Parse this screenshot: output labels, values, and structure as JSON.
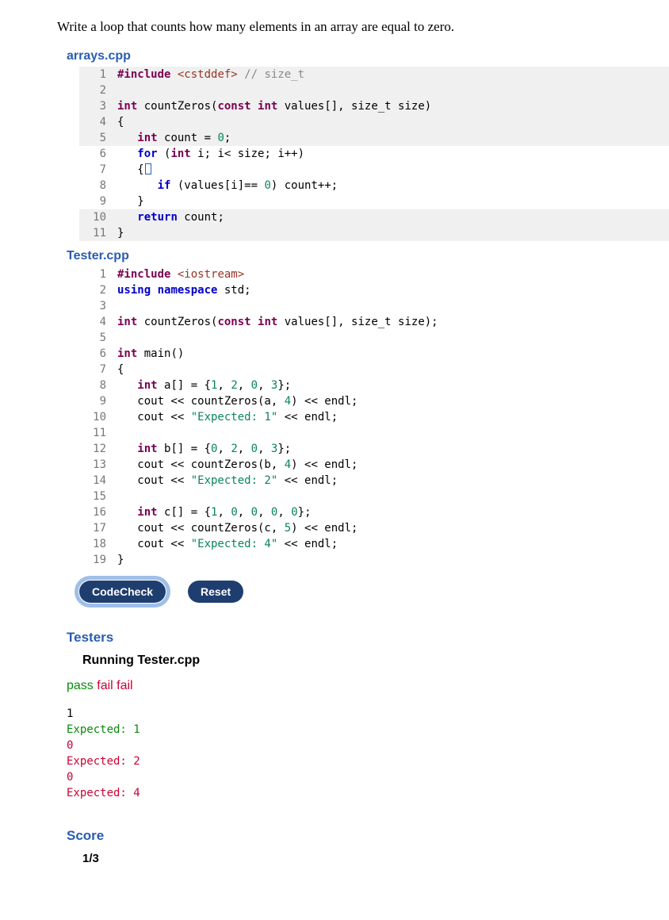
{
  "prompt": "Write a loop that counts how many elements in an array are equal to zero.",
  "files": {
    "arrays": {
      "name": "arrays.cpp",
      "lines": [
        {
          "n": "1",
          "bg": true,
          "tokens": [
            [
              "pre",
              "#include"
            ],
            [
              "pl",
              " "
            ],
            [
              "inc",
              "<cstddef>"
            ],
            [
              "pl",
              " "
            ],
            [
              "cmt",
              "// size_t"
            ]
          ]
        },
        {
          "n": "2",
          "bg": true,
          "tokens": []
        },
        {
          "n": "3",
          "bg": true,
          "tokens": [
            [
              "type",
              "int"
            ],
            [
              "pl",
              " countZeros("
            ],
            [
              "type",
              "const int"
            ],
            [
              "pl",
              " values[], size_t size)"
            ]
          ]
        },
        {
          "n": "4",
          "bg": true,
          "tokens": [
            [
              "pl",
              "{"
            ]
          ]
        },
        {
          "n": "5",
          "bg": true,
          "tokens": [
            [
              "pl",
              "   "
            ],
            [
              "type",
              "int"
            ],
            [
              "pl",
              " count = "
            ],
            [
              "num",
              "0"
            ],
            [
              "pl",
              ";"
            ]
          ]
        },
        {
          "n": "6",
          "bg": false,
          "tokens": [
            [
              "pl",
              "   "
            ],
            [
              "kw",
              "for"
            ],
            [
              "pl",
              " ("
            ],
            [
              "type",
              "int"
            ],
            [
              "pl",
              " i; i< size; i++)"
            ]
          ]
        },
        {
          "n": "7",
          "bg": false,
          "tokens": [
            [
              "pl",
              "   {"
            ],
            [
              "cursor",
              ""
            ]
          ]
        },
        {
          "n": "8",
          "bg": false,
          "tokens": [
            [
              "pl",
              "      "
            ],
            [
              "kw",
              "if"
            ],
            [
              "pl",
              " (values[i]== "
            ],
            [
              "num",
              "0"
            ],
            [
              "pl",
              ") count++;"
            ]
          ]
        },
        {
          "n": "9",
          "bg": false,
          "tokens": [
            [
              "pl",
              "   }"
            ]
          ]
        },
        {
          "n": "10",
          "bg": true,
          "tokens": [
            [
              "pl",
              "   "
            ],
            [
              "kw",
              "return"
            ],
            [
              "pl",
              " count;"
            ]
          ]
        },
        {
          "n": "11",
          "bg": true,
          "tokens": [
            [
              "pl",
              "}"
            ]
          ]
        }
      ]
    },
    "tester": {
      "name": "Tester.cpp",
      "lines": [
        {
          "n": "1",
          "tokens": [
            [
              "pre",
              "#include"
            ],
            [
              "pl",
              " "
            ],
            [
              "inc",
              "<iostream>"
            ]
          ]
        },
        {
          "n": "2",
          "tokens": [
            [
              "kw",
              "using"
            ],
            [
              "pl",
              " "
            ],
            [
              "kw",
              "namespace"
            ],
            [
              "pl",
              " std;"
            ]
          ]
        },
        {
          "n": "3",
          "tokens": []
        },
        {
          "n": "4",
          "tokens": [
            [
              "type",
              "int"
            ],
            [
              "pl",
              " countZeros("
            ],
            [
              "type",
              "const int"
            ],
            [
              "pl",
              " values[], size_t size);"
            ]
          ]
        },
        {
          "n": "5",
          "tokens": []
        },
        {
          "n": "6",
          "tokens": [
            [
              "type",
              "int"
            ],
            [
              "pl",
              " main()"
            ]
          ]
        },
        {
          "n": "7",
          "tokens": [
            [
              "pl",
              "{"
            ]
          ]
        },
        {
          "n": "8",
          "tokens": [
            [
              "pl",
              "   "
            ],
            [
              "type",
              "int"
            ],
            [
              "pl",
              " a[] = {"
            ],
            [
              "num",
              "1"
            ],
            [
              "pl",
              ", "
            ],
            [
              "num",
              "2"
            ],
            [
              "pl",
              ", "
            ],
            [
              "num",
              "0"
            ],
            [
              "pl",
              ", "
            ],
            [
              "num",
              "3"
            ],
            [
              "pl",
              "};"
            ]
          ]
        },
        {
          "n": "9",
          "tokens": [
            [
              "pl",
              "   cout << countZeros(a, "
            ],
            [
              "num",
              "4"
            ],
            [
              "pl",
              ") << endl;"
            ]
          ]
        },
        {
          "n": "10",
          "tokens": [
            [
              "pl",
              "   cout << "
            ],
            [
              "str",
              "\"Expected: 1\""
            ],
            [
              "pl",
              " << endl;"
            ]
          ]
        },
        {
          "n": "11",
          "tokens": []
        },
        {
          "n": "12",
          "tokens": [
            [
              "pl",
              "   "
            ],
            [
              "type",
              "int"
            ],
            [
              "pl",
              " b[] = {"
            ],
            [
              "num",
              "0"
            ],
            [
              "pl",
              ", "
            ],
            [
              "num",
              "2"
            ],
            [
              "pl",
              ", "
            ],
            [
              "num",
              "0"
            ],
            [
              "pl",
              ", "
            ],
            [
              "num",
              "3"
            ],
            [
              "pl",
              "};"
            ]
          ]
        },
        {
          "n": "13",
          "tokens": [
            [
              "pl",
              "   cout << countZeros(b, "
            ],
            [
              "num",
              "4"
            ],
            [
              "pl",
              ") << endl;"
            ]
          ]
        },
        {
          "n": "14",
          "tokens": [
            [
              "pl",
              "   cout << "
            ],
            [
              "str",
              "\"Expected: 2\""
            ],
            [
              "pl",
              " << endl;"
            ]
          ]
        },
        {
          "n": "15",
          "tokens": []
        },
        {
          "n": "16",
          "tokens": [
            [
              "pl",
              "   "
            ],
            [
              "type",
              "int"
            ],
            [
              "pl",
              " c[] = {"
            ],
            [
              "num",
              "1"
            ],
            [
              "pl",
              ", "
            ],
            [
              "num",
              "0"
            ],
            [
              "pl",
              ", "
            ],
            [
              "num",
              "0"
            ],
            [
              "pl",
              ", "
            ],
            [
              "num",
              "0"
            ],
            [
              "pl",
              ", "
            ],
            [
              "num",
              "0"
            ],
            [
              "pl",
              "};"
            ]
          ]
        },
        {
          "n": "17",
          "tokens": [
            [
              "pl",
              "   cout << countZeros(c, "
            ],
            [
              "num",
              "5"
            ],
            [
              "pl",
              ") << endl;"
            ]
          ]
        },
        {
          "n": "18",
          "tokens": [
            [
              "pl",
              "   cout << "
            ],
            [
              "str",
              "\"Expected: 4\""
            ],
            [
              "pl",
              " << endl;"
            ]
          ]
        },
        {
          "n": "19",
          "tokens": [
            [
              "pl",
              "}"
            ]
          ]
        }
      ]
    }
  },
  "buttons": {
    "check": "CodeCheck",
    "reset": "Reset"
  },
  "testers": {
    "heading": "Testers",
    "running": "Running Tester.cpp",
    "summary": [
      {
        "status": "pass",
        "text": "pass"
      },
      {
        "status": "fail",
        "text": "fail"
      },
      {
        "status": "fail",
        "text": "fail"
      }
    ],
    "output": [
      {
        "kind": "out",
        "status": "pass",
        "text": "1"
      },
      {
        "kind": "exp",
        "status": "pass",
        "text": "Expected: 1"
      },
      {
        "kind": "out",
        "status": "fail",
        "text": "0"
      },
      {
        "kind": "exp",
        "status": "fail",
        "text": "Expected: 2"
      },
      {
        "kind": "out",
        "status": "fail",
        "text": "0"
      },
      {
        "kind": "exp",
        "status": "fail",
        "text": "Expected: 4"
      }
    ]
  },
  "score": {
    "heading": "Score",
    "value": "1/3"
  }
}
